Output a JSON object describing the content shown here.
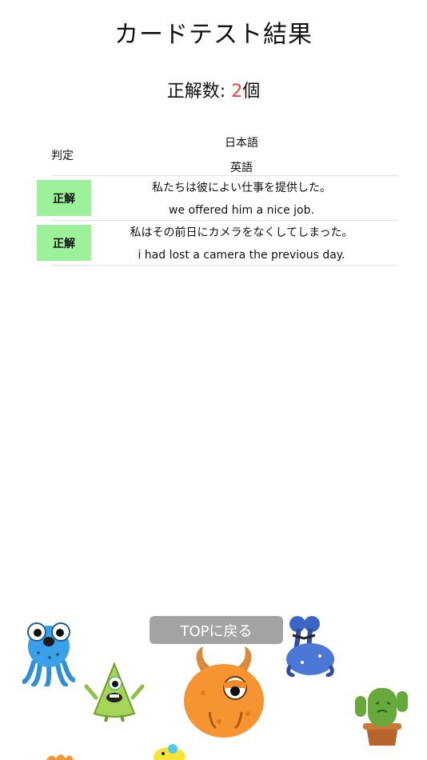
{
  "header": {
    "title": "カードテスト結果"
  },
  "score": {
    "label": "正解数: ",
    "value": "2",
    "unit": "個"
  },
  "table": {
    "columns": {
      "judge": "判定",
      "japanese": "日本語",
      "english": "英語"
    },
    "rows": [
      {
        "judge": "正解",
        "japanese": "私たちは彼によい仕事を提供した。",
        "english": "we offered him a nice job."
      },
      {
        "judge": "正解",
        "japanese": "私はその前日にカメラをなくしてしまった。",
        "english": "i had lost a camera the previous day."
      }
    ]
  },
  "footer": {
    "back_button": "TOPに戻る"
  },
  "colors": {
    "correct_badge": "#9cf29a",
    "score_accent": "#ff3b30",
    "button_bg": "#a3a3a3"
  },
  "decorations": [
    "blue-monster-icon",
    "green-alien-icon",
    "orange-monster-icon",
    "navy-monster-icon",
    "cactus-icon",
    "yellow-chick-icon"
  ]
}
